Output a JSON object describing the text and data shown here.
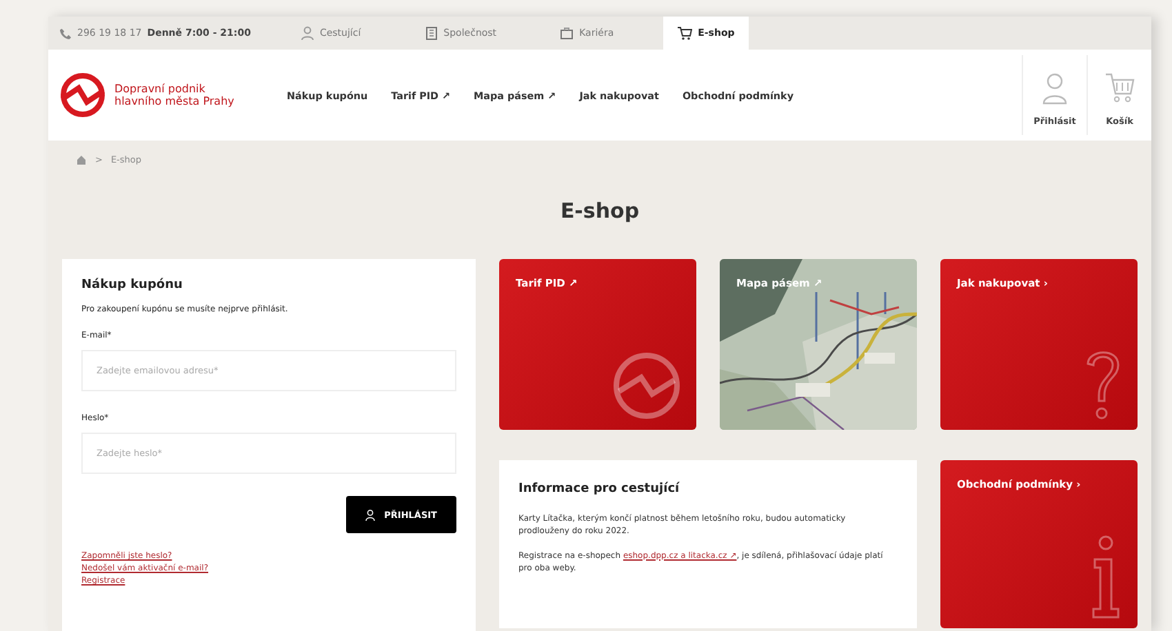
{
  "top_bar": {
    "phone": "296 19 18 17",
    "hours": "Denně 7:00 - 21:00",
    "tabs": [
      {
        "label": "Cestující",
        "kind": "person",
        "selected": false
      },
      {
        "label": "Společnost",
        "kind": "building",
        "selected": false
      },
      {
        "label": "Kariéra",
        "kind": "briefcase",
        "selected": false
      },
      {
        "label": "E-shop",
        "kind": "cart",
        "selected": true
      }
    ]
  },
  "header": {
    "logo_text": "Dopravní podnik hlavního města Prahy",
    "nav": [
      {
        "label": "Nákup kupónu"
      },
      {
        "label": "Tarif PID ↗"
      },
      {
        "label": "Mapa pásem ↗"
      },
      {
        "label": "Jak nakupovat"
      },
      {
        "label": "Obchodní podmínky"
      }
    ],
    "account": [
      {
        "label": "Přihlásit",
        "kind": "user"
      },
      {
        "label": "Košík",
        "kind": "cart"
      }
    ]
  },
  "breadcrumb": {
    "separator": ">",
    "current": "E-shop"
  },
  "heading": "E-shop",
  "login": {
    "title": "Nákup kupónu",
    "intro": "Pro zakoupení kupónu se musíte nejprve přihlásit.",
    "fields": [
      {
        "label": "E-mail*",
        "placeholder": "Zadejte emailovou adresu*"
      },
      {
        "label": "Heslo*",
        "placeholder": "Zadejte heslo*"
      }
    ],
    "button": "PŘIHLÁSIT",
    "links": [
      "Zapomněli jste heslo?",
      "Nedošel vám aktivační e-mail?",
      "Registrace"
    ]
  },
  "tiles": [
    {
      "title": "Tarif PID ↗",
      "kind": "logo"
    },
    {
      "title": "Mapa pásem ↗",
      "kind": "picture"
    },
    {
      "title": "Jak nakupovat ›",
      "kind": "question"
    }
  ],
  "info": {
    "title": "Informace pro cestující",
    "paragraphs": [
      {
        "text": "Karty Lítačka, kterým končí platnost během letošního roku, budou automaticky prodlouženy do roku 2022."
      },
      {
        "text": "Registrace na e-shopech ",
        "link": "eshop.dpp.cz a litacka.cz ↗",
        "after": ", je sdílená, přihlašovací údaje platí pro oba weby."
      }
    ]
  },
  "terms_tile": {
    "title": "Obchodní podmínky ›",
    "kind": "info"
  }
}
